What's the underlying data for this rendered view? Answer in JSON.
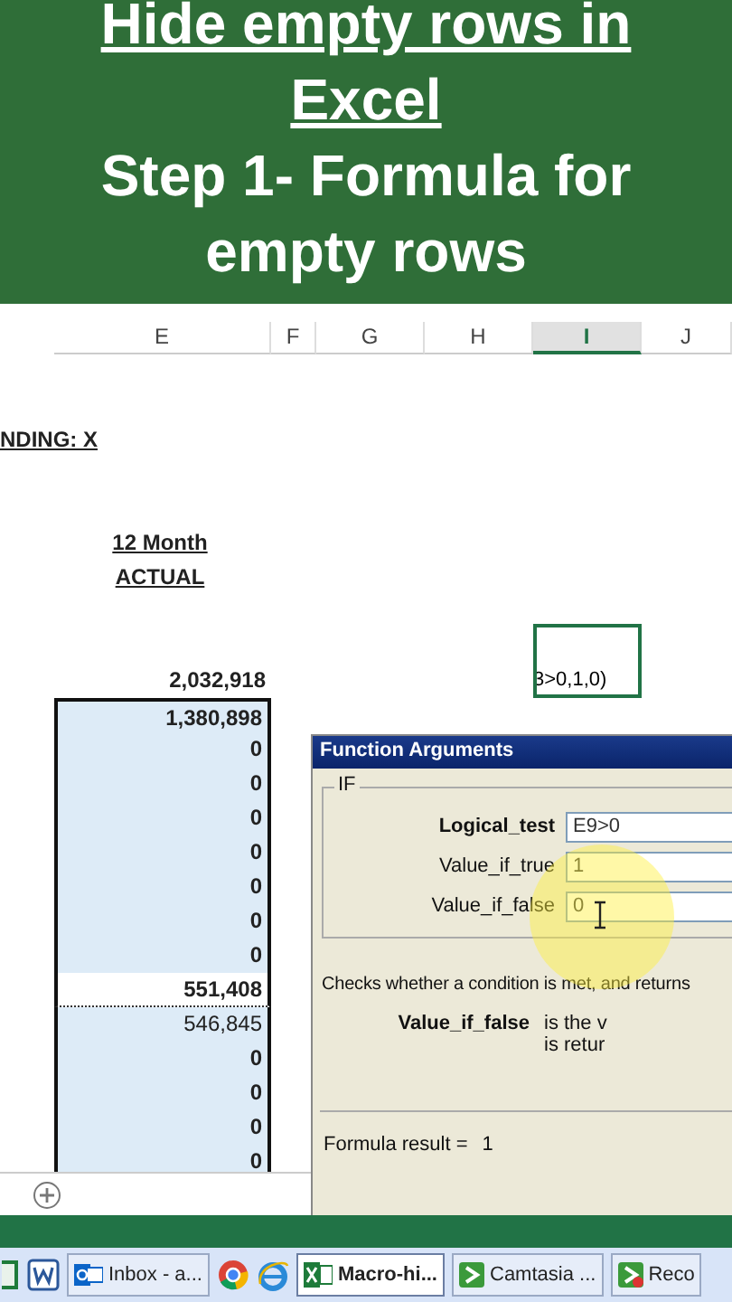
{
  "banner": {
    "title": "Hide empty rows in Excel",
    "subtitle": "Step 1- Formula for empty rows"
  },
  "sheet": {
    "columns": [
      {
        "label": "E",
        "selected": false
      },
      {
        "label": "F",
        "selected": false
      },
      {
        "label": "G",
        "selected": false
      },
      {
        "label": "H",
        "selected": false
      },
      {
        "label": "I",
        "selected": true
      },
      {
        "label": "J",
        "selected": false
      }
    ],
    "rows": [
      {
        "kind": "blank"
      },
      {
        "kind": "blank"
      },
      {
        "kind": "heading",
        "text": "NDING: X"
      },
      {
        "kind": "blank"
      },
      {
        "kind": "blank"
      },
      {
        "kind": "caption",
        "text": "12 Month"
      },
      {
        "kind": "caption",
        "text": "ACTUAL"
      },
      {
        "kind": "blank"
      },
      {
        "kind": "blank"
      },
      {
        "kind": "value",
        "value": "2,032,918",
        "bold": true,
        "in_range": false,
        "shaded": false,
        "marquee": false,
        "formula": "3>0,1,0)"
      },
      {
        "kind": "value",
        "value": "1,380,898",
        "bold": true,
        "in_range": true,
        "shaded": true,
        "marquee": false
      },
      {
        "kind": "value",
        "value": "0",
        "bold": true,
        "in_range": true,
        "shaded": true,
        "marquee": false
      },
      {
        "kind": "value",
        "value": "0",
        "bold": true,
        "in_range": true,
        "shaded": true,
        "marquee": false
      },
      {
        "kind": "value",
        "value": "0",
        "bold": true,
        "in_range": true,
        "shaded": true,
        "marquee": false
      },
      {
        "kind": "value",
        "value": "0",
        "bold": true,
        "in_range": true,
        "shaded": true,
        "marquee": false
      },
      {
        "kind": "value",
        "value": "0",
        "bold": true,
        "in_range": true,
        "shaded": true,
        "marquee": false
      },
      {
        "kind": "value",
        "value": "0",
        "bold": true,
        "in_range": true,
        "shaded": true,
        "marquee": false
      },
      {
        "kind": "value",
        "value": "0",
        "bold": true,
        "in_range": true,
        "shaded": true,
        "marquee": false
      },
      {
        "kind": "value",
        "value": "551,408",
        "bold": true,
        "in_range": true,
        "shaded": false,
        "marquee": true
      },
      {
        "kind": "value",
        "value": "546,845",
        "bold": false,
        "in_range": true,
        "shaded": true,
        "marquee": false
      },
      {
        "kind": "value",
        "value": "0",
        "bold": true,
        "in_range": true,
        "shaded": true,
        "marquee": false
      },
      {
        "kind": "value",
        "value": "0",
        "bold": true,
        "in_range": true,
        "shaded": true,
        "marquee": false
      },
      {
        "kind": "value",
        "value": "0",
        "bold": true,
        "in_range": true,
        "shaded": true,
        "marquee": false
      },
      {
        "kind": "value",
        "value": "0",
        "bold": true,
        "in_range": true,
        "shaded": true,
        "marquee": false
      }
    ]
  },
  "dialog": {
    "title": "Function Arguments",
    "group": "IF",
    "arguments": [
      {
        "label": "Logical_test",
        "value": "E9>0",
        "bold": true
      },
      {
        "label": "Value_if_true",
        "value": "1",
        "bold": false
      },
      {
        "label": "Value_if_false",
        "value": "0",
        "bold": false
      }
    ],
    "description": "Checks whether a condition is met, and returns",
    "argument_name": "Value_if_false",
    "argument_help": [
      "is the v",
      "is retur"
    ],
    "result_label": "Formula result =",
    "result_value": "1"
  },
  "taskbar": {
    "buttons": [
      {
        "label": "Inbox - a...",
        "selected": false
      },
      {
        "label": "Macro-hi...",
        "selected": true
      },
      {
        "label": "Camtasia ...",
        "selected": false
      },
      {
        "label": "Reco",
        "selected": false
      }
    ]
  }
}
